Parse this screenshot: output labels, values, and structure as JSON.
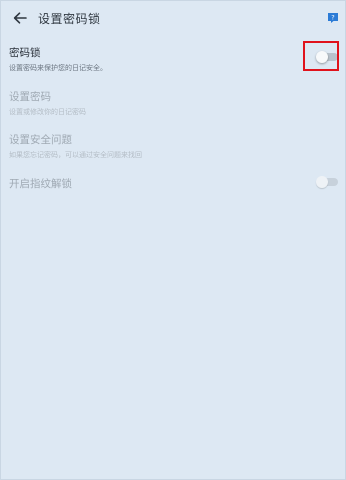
{
  "header": {
    "title": "设置密码锁",
    "back_icon": "arrow-left-icon",
    "help_icon": "help-icon",
    "accent_color": "#2b7bd6"
  },
  "settings": [
    {
      "title": "密码锁",
      "desc": "设置密码来保护您的日记安全。",
      "enabled": true,
      "toggle": "off"
    },
    {
      "title": "设置密码",
      "desc": "设置或修改你的日记密码",
      "enabled": false
    },
    {
      "title": "设置安全问题",
      "desc": "如果您忘记密码，可以通过安全问题来找回",
      "enabled": false
    },
    {
      "title": "开启指纹解锁",
      "desc": "",
      "enabled": false,
      "toggle": "off"
    }
  ],
  "highlight_color": "#e0121b"
}
